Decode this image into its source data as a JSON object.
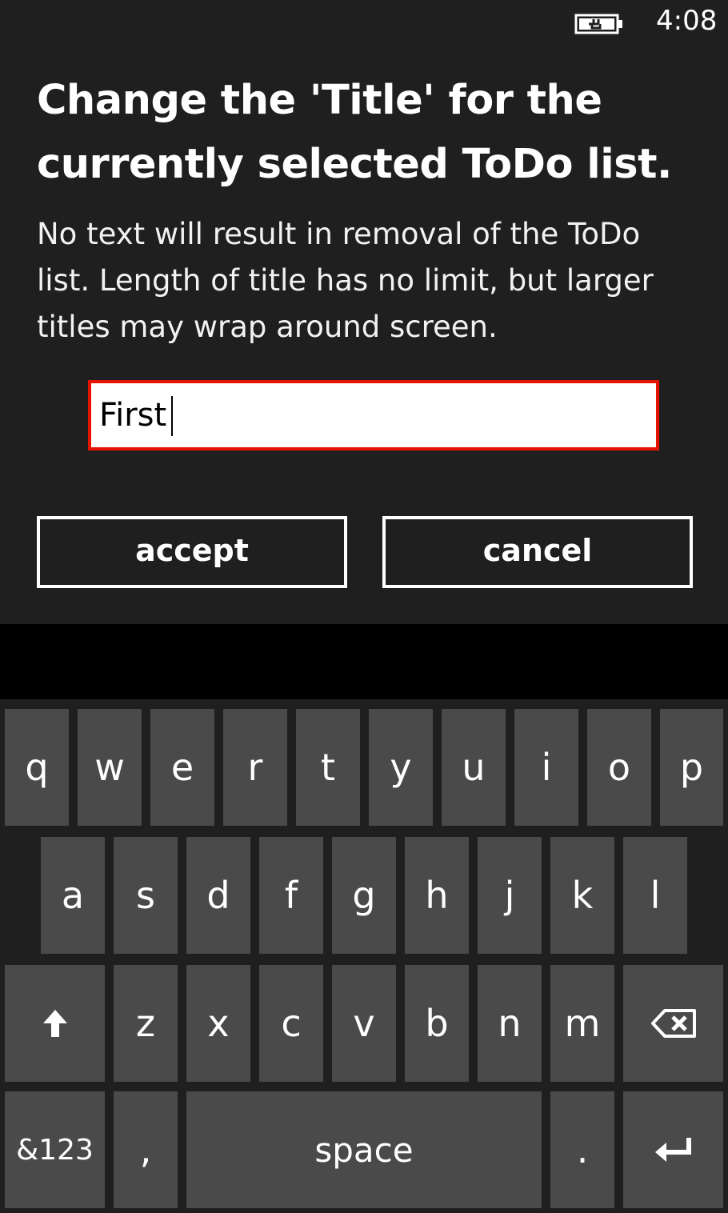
{
  "status": {
    "time": "4:08",
    "battery_icon": "battery-charging-icon"
  },
  "dialog": {
    "title": "Change the 'Title' for the currently selected ToDo list.",
    "description": "No text will result in removal of the ToDo list. Length of title has no limit, but larger titles may wrap around screen.",
    "input_value": "First",
    "accept_label": "accept",
    "cancel_label": "cancel",
    "input_border_color": "#e51400"
  },
  "keyboard": {
    "row1": [
      "q",
      "w",
      "e",
      "r",
      "t",
      "y",
      "u",
      "i",
      "o",
      "p"
    ],
    "row2": [
      "a",
      "s",
      "d",
      "f",
      "g",
      "h",
      "j",
      "k",
      "l"
    ],
    "row3": [
      "z",
      "x",
      "c",
      "v",
      "b",
      "n",
      "m"
    ],
    "shift_icon": "shift-arrow-icon",
    "backspace_icon": "backspace-icon",
    "symbols_label": "&123",
    "comma_label": ",",
    "space_label": "space",
    "period_label": ".",
    "enter_icon": "enter-icon"
  }
}
